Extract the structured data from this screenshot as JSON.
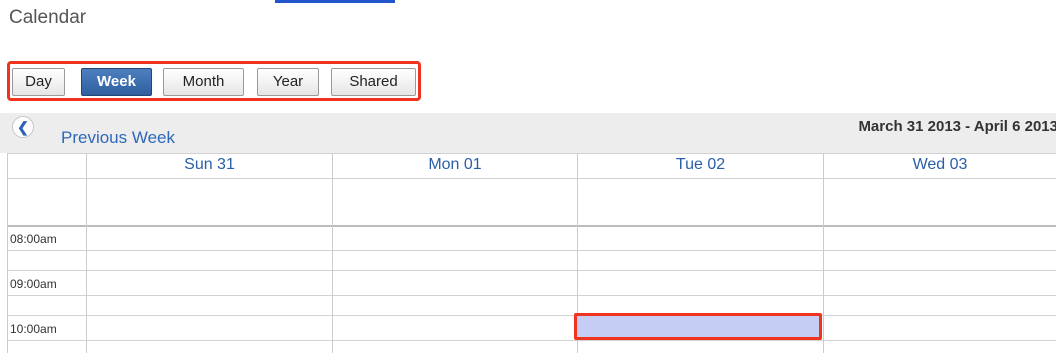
{
  "page": {
    "title": "Calendar"
  },
  "views": [
    {
      "label": "Day",
      "active": false
    },
    {
      "label": "Week",
      "active": true
    },
    {
      "label": "Month",
      "active": false
    },
    {
      "label": "Year",
      "active": false
    },
    {
      "label": "Shared",
      "active": false
    }
  ],
  "nav": {
    "previous_label": "Previous Week",
    "previous_icon": "chevron-left-icon",
    "date_range": "March 31 2013 - April 6 2013"
  },
  "days": [
    "Sun 31",
    "Mon 01",
    "Tue 02",
    "Wed 03"
  ],
  "time_slots": [
    "08:00am",
    "09:00am",
    "10:00am"
  ],
  "selection": {
    "day": "Tue 02",
    "time": "10:00am"
  },
  "colors": {
    "accent": "#2f68b8",
    "highlight_border": "#f0331f",
    "selected_slot": "#c5cdf4",
    "active_button": "#3a6aaa"
  }
}
